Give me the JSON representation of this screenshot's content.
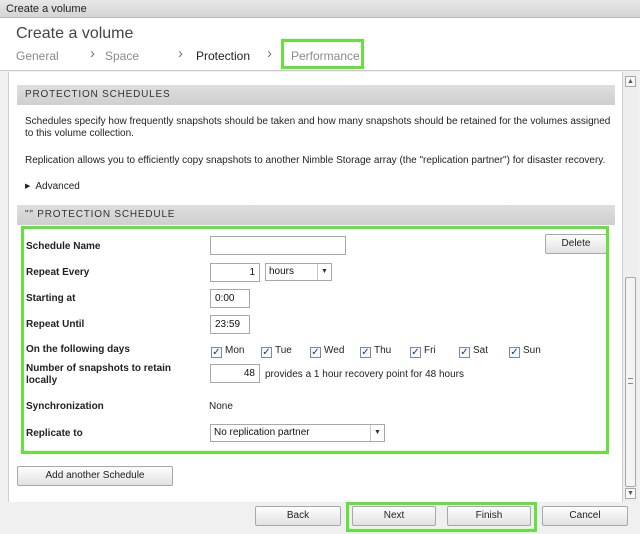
{
  "window": {
    "title": "Create a volume"
  },
  "header": {
    "title": "Create a volume",
    "steps": [
      {
        "label": "General"
      },
      {
        "label": "Space"
      },
      {
        "label": "Protection"
      },
      {
        "label": "Performance"
      }
    ],
    "separator": "›"
  },
  "protection": {
    "section_title": "PROTECTION SCHEDULES",
    "description": "Schedules specify how frequently snapshots should be taken and how many snapshots should be retained for the volumes assigned to this volume collection.",
    "replication_text": "Replication allows you to efficiently copy snapshots to another Nimble Storage array (the \"replication partner\") for disaster recovery.",
    "advanced_label": "Advanced"
  },
  "schedule": {
    "section_title": "\"\" PROTECTION SCHEDULE",
    "delete_label": "Delete",
    "name_label": "Schedule Name",
    "name_value": "",
    "repeat_every_label": "Repeat Every",
    "repeat_every_value": "1",
    "repeat_unit": "hours",
    "starting_at_label": "Starting at",
    "starting_at_value": "0:00",
    "repeat_until_label": "Repeat Until",
    "repeat_until_value": "23:59",
    "days_label": "On the following days",
    "days": [
      {
        "label": "Mon",
        "checked": true
      },
      {
        "label": "Tue",
        "checked": true
      },
      {
        "label": "Wed",
        "checked": true
      },
      {
        "label": "Thu",
        "checked": true
      },
      {
        "label": "Fri",
        "checked": true
      },
      {
        "label": "Sat",
        "checked": true
      },
      {
        "label": "Sun",
        "checked": true
      }
    ],
    "check_mark": "✓",
    "snapshots_label": "Number of snapshots to retain locally",
    "snapshots_value": "48",
    "snapshots_hint": "provides a 1 hour recovery point for 48 hours",
    "sync_label": "Synchronization",
    "sync_value": "None",
    "replicate_label": "Replicate to",
    "replicate_value": "No replication partner"
  },
  "add_schedule_label": "Add another Schedule",
  "footer": {
    "back": "Back",
    "next": "Next",
    "finish": "Finish",
    "cancel": "Cancel"
  },
  "colors": {
    "highlight": "#62e23a"
  }
}
